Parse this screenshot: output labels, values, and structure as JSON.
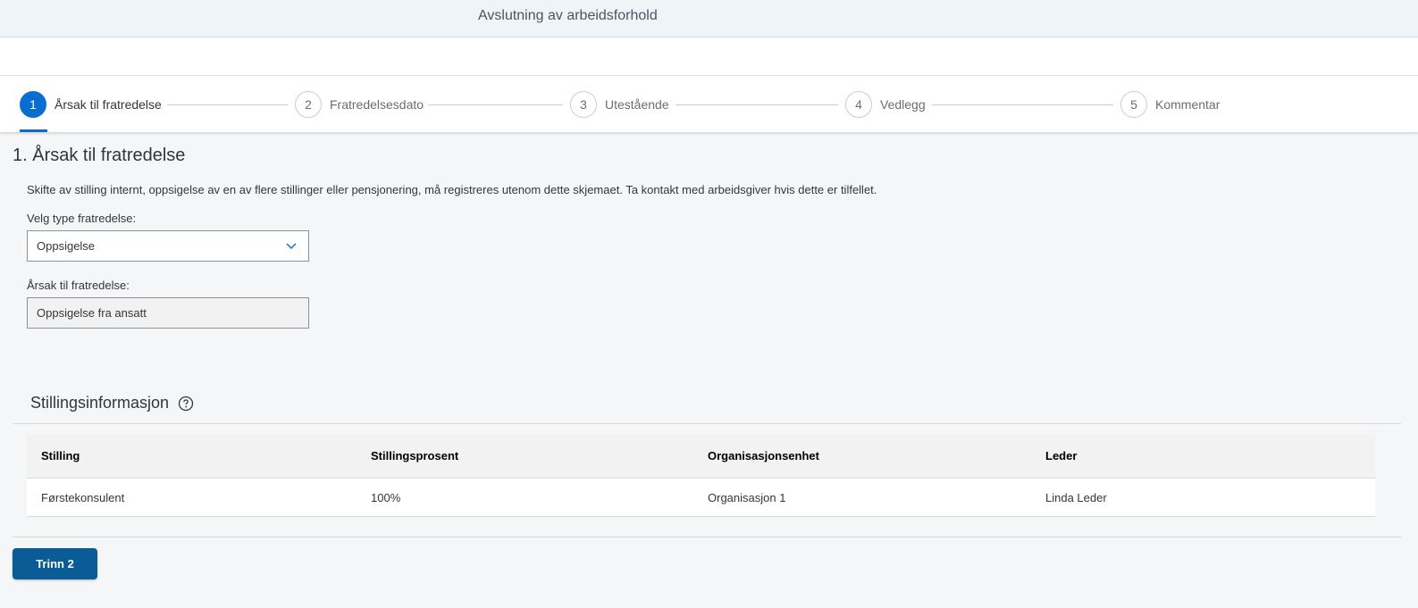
{
  "header": {
    "title": "Avslutning av arbeidsforhold"
  },
  "wizard": {
    "steps": [
      {
        "number": "1",
        "label": "Årsak til fratredelse",
        "active": true
      },
      {
        "number": "2",
        "label": "Fratredelsesdato",
        "active": false
      },
      {
        "number": "3",
        "label": "Utestående",
        "active": false
      },
      {
        "number": "4",
        "label": "Vedlegg",
        "active": false
      },
      {
        "number": "5",
        "label": "Kommentar",
        "active": false
      }
    ],
    "accent_color": "#0a6ed1"
  },
  "section": {
    "title": "1. Årsak til fratredelse",
    "info": "Skifte av stilling internt, oppsigelse av en av flere stillinger eller pensjonering, må registreres utenom dette skjemaet. Ta kontakt med arbeidsgiver hvis dette er tilfellet.",
    "type_label": "Velg type fratredelse:",
    "type_value": "Oppsigelse",
    "reason_label": "Årsak til fratredelse:",
    "reason_value": "Oppsigelse fra ansatt"
  },
  "position_info": {
    "title": "Stillingsinformasjon",
    "help_icon": "question-circle-icon",
    "columns": [
      "Stilling",
      "Stillingsprosent",
      "Organisasjonsenhet",
      "Leder"
    ],
    "rows": [
      [
        "Førstekonsulent",
        "100%",
        "Organisasjon 1",
        "Linda Leder"
      ]
    ]
  },
  "footer": {
    "next_button": "Trinn 2",
    "button_color": "#0a5c96"
  }
}
